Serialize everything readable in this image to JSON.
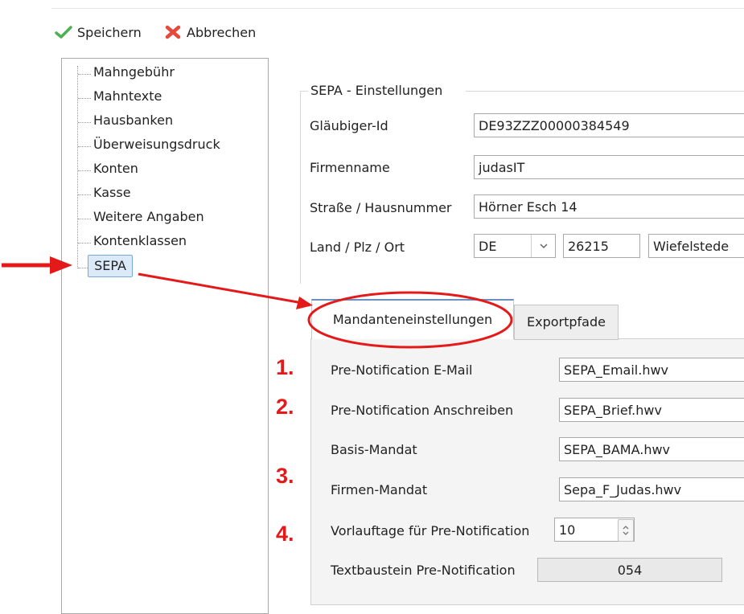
{
  "toolbar": {
    "save_label": "Speichern",
    "cancel_label": "Abbrechen",
    "save_color": "#4caf50",
    "cancel_color": "#e64a3c"
  },
  "tree": {
    "items": [
      {
        "label": "Mahngebühr"
      },
      {
        "label": "Mahntexte"
      },
      {
        "label": "Hausbanken"
      },
      {
        "label": "Überweisungsdruck"
      },
      {
        "label": "Konten"
      },
      {
        "label": "Kasse"
      },
      {
        "label": "Weitere Angaben"
      },
      {
        "label": "Kontenklassen"
      },
      {
        "label": "SEPA",
        "selected": true
      }
    ]
  },
  "sepa_group": {
    "title": "SEPA - Einstellungen",
    "creditor_id": {
      "label": "Gläubiger-Id",
      "value": "DE93ZZZ00000384549"
    },
    "company_name": {
      "label": "Firmenname",
      "value": "judasIT"
    },
    "street": {
      "label": "Straße / Hausnummer",
      "value": "Hörner Esch 14"
    },
    "location": {
      "label": "Land / Plz / Ort",
      "country": "DE",
      "zip": "26215",
      "city": "Wiefelstede"
    }
  },
  "tabs": [
    {
      "label": "Mandanteneinstellungen",
      "active": true
    },
    {
      "label": "Exportpfade",
      "active": false
    }
  ],
  "mandant": {
    "rows": [
      {
        "label": "Pre-Notification E-Mail",
        "value": "SEPA_Email.hwv"
      },
      {
        "label": "Pre-Notification Anschreiben",
        "value": "SEPA_Brief.hwv"
      },
      {
        "label": "Basis-Mandat",
        "value": "SEPA_BAMA.hwv"
      },
      {
        "label": "Firmen-Mandat",
        "value": "Sepa_F_Judas.hwv"
      }
    ],
    "lead_days": {
      "label": "Vorlauftage für Pre-Notification",
      "value": "10"
    },
    "text_block": {
      "label": "Textbaustein Pre-Notification",
      "value": "054"
    }
  },
  "annotations": {
    "numbers": [
      "1.",
      "2.",
      "3.",
      "4."
    ],
    "color": "#e41a1a"
  }
}
